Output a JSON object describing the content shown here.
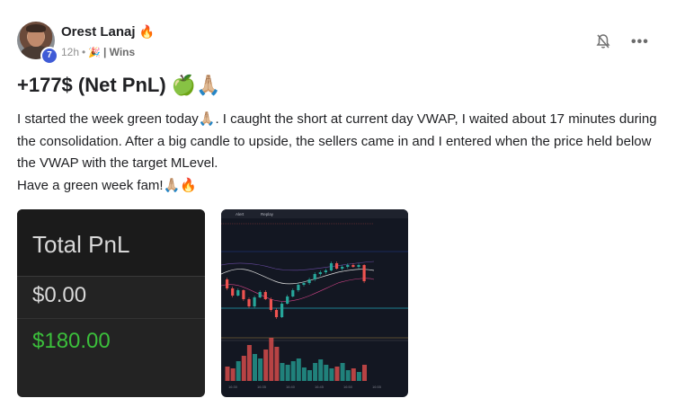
{
  "post": {
    "author": "Orest Lanaj",
    "author_emoji": "🔥",
    "level": "7",
    "time": "12h",
    "dot": "•",
    "category_emoji": "🎉",
    "category": "| Wins",
    "more": "•••",
    "title": "+177$ (Net PnL) 🍏🙏🏼",
    "body_lines": [
      "I started the week green today🙏🏼. I caught the short at current day VWAP, I waited about 17 minutes during the consolidation. After a big candle to upside, the sellers came in and I entered when the price held below the VWAP with the target MLevel.",
      "Have a green week fam!🙏🏼🔥"
    ]
  },
  "pnl_image": {
    "label": "Total PnL",
    "value1": "$0.00",
    "value2": "$180.00"
  },
  "chart_image": {
    "toolbar_alert": "Alert",
    "toolbar_replay": "Replay",
    "time_labels": [
      "16:30",
      "16:35",
      "16:40",
      "16:45",
      "16:50",
      "16:55"
    ]
  },
  "colors": {
    "up": "#26a69a",
    "down": "#ef5350",
    "level_badge": "#3f5bd6",
    "pnl_green": "#3bbf3b"
  }
}
